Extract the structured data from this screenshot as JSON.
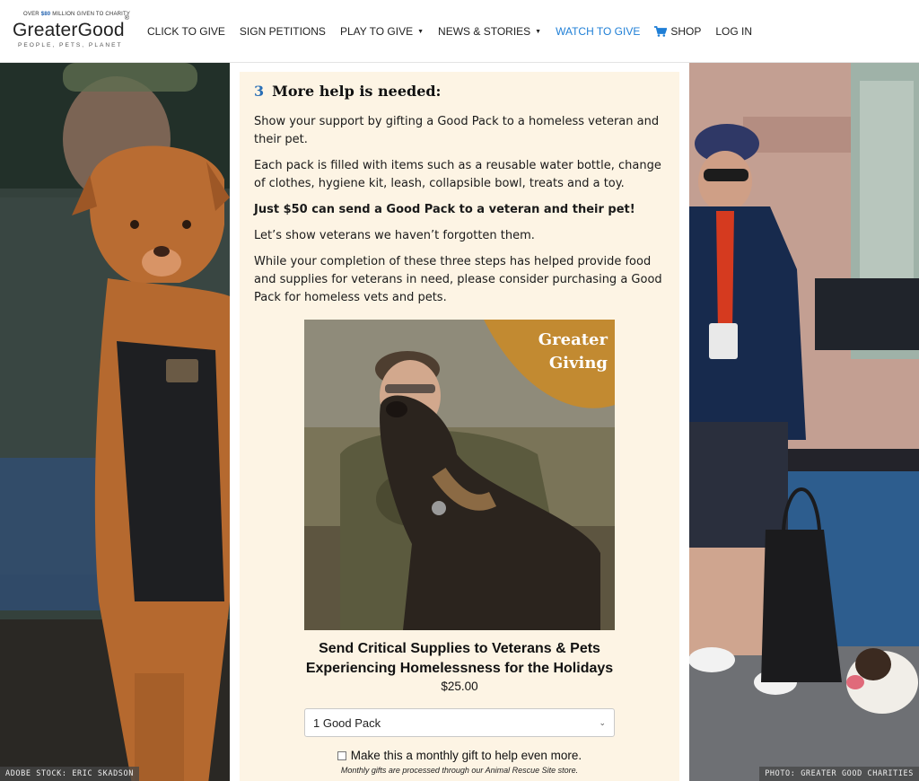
{
  "header": {
    "logo_tagline_prefix": "OVER",
    "logo_tagline_amount": "$80",
    "logo_tagline_suffix": "MILLION GIVEN TO CHARITY",
    "logo_name": "GreaterGood",
    "logo_reg": "®",
    "logo_sub": "PEOPLE, PETS, PLANET",
    "nav": [
      {
        "label": "CLICK TO GIVE"
      },
      {
        "label": "SIGN PETITIONS"
      },
      {
        "label": "PLAY TO GIVE",
        "caret": "▼"
      },
      {
        "label": "NEWS & STORIES",
        "caret": "▼"
      },
      {
        "label": "WATCH TO GIVE"
      },
      {
        "label": "SHOP"
      },
      {
        "label": "LOG IN"
      }
    ],
    "accent_color": "#1f7fd6"
  },
  "left_photo": {
    "credit": "ADOBE STOCK: ERIC SKADSON"
  },
  "right_photo": {
    "credit": "PHOTO: GREATER GOOD CHARITIES"
  },
  "card": {
    "step_number": "3",
    "step_title": "More help is needed:",
    "paragraphs": [
      "Show your support by gifting a Good Pack to a homeless veteran and their pet.",
      "Each pack is filled with items such as a reusable water bottle, change of clothes, hygiene kit, leash, collapsible bowl, treats and a toy.",
      "Just $50 can send a Good Pack to a veteran and their pet!",
      "Let’s show veterans we haven’t forgotten them.",
      "While your completion of these three steps has helped provide food and supplies for veterans in need, please consider purchasing a Good Pack for homeless vets and pets."
    ],
    "image_badge_line1": "Greater",
    "image_badge_line2": "Giving",
    "product_title_line1": "Send Critical Supplies to Veterans & Pets",
    "product_title_line2": "Experiencing Homelessness for the Holidays",
    "price": "$25.00",
    "quantity_select": {
      "selected": "1 Good Pack"
    },
    "monthly_label": "Make this a monthly gift to help even more.",
    "monthly_checked": false,
    "monthly_note": "Monthly gifts are processed through our Animal Rescue Site store."
  }
}
